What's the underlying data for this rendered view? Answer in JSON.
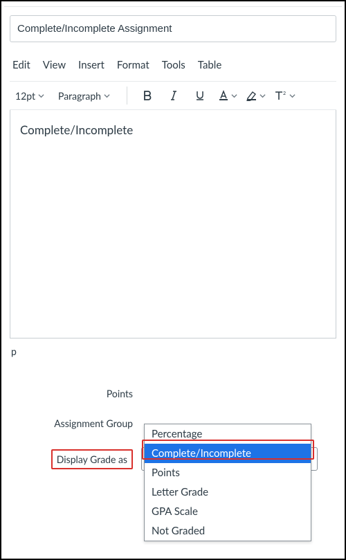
{
  "title_input": {
    "value": "Complete/Incomplete Assignment"
  },
  "editor": {
    "menubar": [
      "Edit",
      "View",
      "Insert",
      "Format",
      "Tools",
      "Table"
    ],
    "font_size": "12pt",
    "block_format": "Paragraph",
    "content": "Complete/Incomplete",
    "status_path": "p"
  },
  "form": {
    "points": {
      "label": "Points"
    },
    "assignment_group": {
      "label": "Assignment Group"
    },
    "display_grade_as": {
      "label": "Display Grade as",
      "selected": "Complete/Incomplete",
      "options": [
        "Percentage",
        "Complete/Incomplete",
        "Points",
        "Letter Grade",
        "GPA Scale",
        "Not Graded"
      ]
    }
  }
}
